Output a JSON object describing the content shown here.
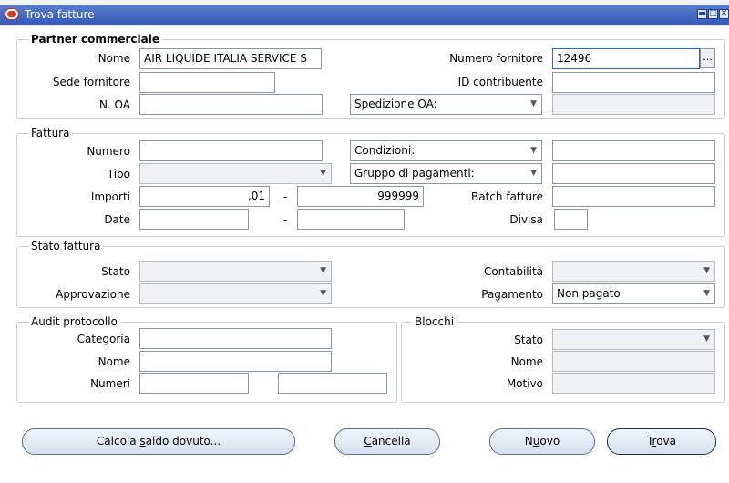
{
  "window": {
    "title": "Trova fatture",
    "controls": [
      "minimize-icon",
      "maximize-icon",
      "close-icon"
    ]
  },
  "partner": {
    "section_title": "Partner commerciale",
    "nome_label": "Nome",
    "nome_value": "AIR LIQUIDE ITALIA SERVICE S",
    "numero_fornitore_label": "Numero fornitore",
    "numero_fornitore_value": "12496",
    "lov_symbol": "...",
    "sede_label": "Sede fornitore",
    "sede_value": "",
    "id_contribuente_label": "ID contribuente",
    "id_contribuente_value": "",
    "noa_label": "N. OA",
    "noa_value": "",
    "spedizione_label": "Spedizione OA:",
    "spedizione_value": ""
  },
  "fattura": {
    "section_title": "Fattura",
    "numero_label": "Numero",
    "numero_value": "",
    "condizioni_label": "Condizioni:",
    "condizioni_value": "",
    "tipo_label": "Tipo",
    "tipo_value": "",
    "gruppo_label": "Gruppo di pagamenti:",
    "gruppo_value": "",
    "importi_label": "Importi",
    "importi_from": ",01",
    "importi_to": "999999",
    "range_dash": "-",
    "batch_label": "Batch fatture",
    "batch_value": "",
    "date_label": "Date",
    "date_from": "",
    "date_to": "",
    "divisa_label": "Divisa",
    "divisa_value": ""
  },
  "stato_fattura": {
    "section_title": "Stato fattura",
    "stato_label": "Stato",
    "stato_value": "",
    "contabilita_label": "Contabilità",
    "contabilita_value": "",
    "approvazione_label": "Approvazione",
    "approvazione_value": "",
    "pagamento_label": "Pagamento",
    "pagamento_value": "Non pagato"
  },
  "audit": {
    "section_title": "Audit protocollo",
    "categoria_label": "Categoria",
    "categoria_value": "",
    "nome_label": "Nome",
    "nome_value": "",
    "numeri_label": "Numeri",
    "numeri_from": "",
    "numeri_to": ""
  },
  "blocchi": {
    "section_title": "Blocchi",
    "stato_label": "Stato",
    "stato_value": "",
    "nome_label": "Nome",
    "nome_value": "",
    "motivo_label": "Motivo",
    "motivo_value": ""
  },
  "buttons": {
    "calcola": {
      "pre": "Calcola ",
      "key": "s",
      "post": "aldo dovuto..."
    },
    "cancella": {
      "pre": "",
      "key": "C",
      "post": "ancella"
    },
    "nuovo": {
      "pre": "N",
      "key": "u",
      "post": "ovo"
    },
    "trova": {
      "pre": "T",
      "key": "r",
      "post": "ova"
    }
  },
  "colors": {
    "titlebar": "#3f63c0",
    "field_highlight": "#2c5fd1",
    "button_face": "#e3ebf5"
  }
}
